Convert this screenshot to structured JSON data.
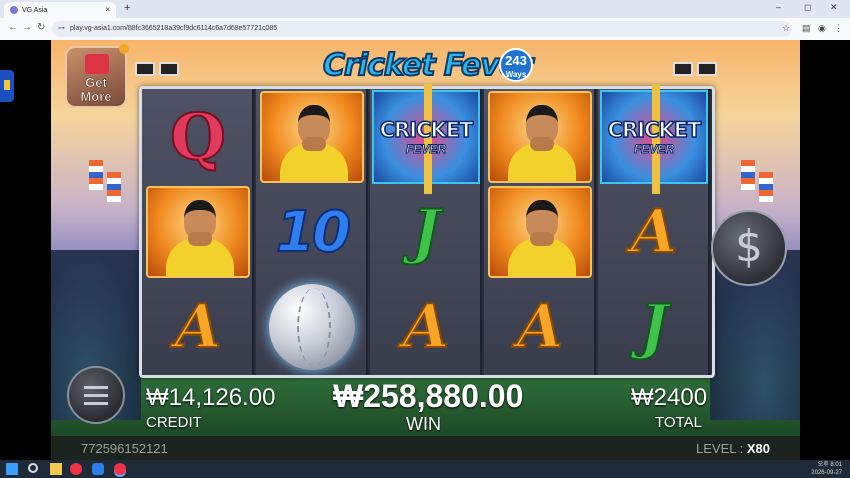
{
  "browser": {
    "tab_title": "VG Asia",
    "tab_close": "×",
    "new_tab": "+",
    "url": "play.vg-asia1.com/88fc3665218a39cf9dc6114c6a7d68e57721c085",
    "nav_back": "←",
    "nav_forward": "→",
    "nav_reload": "↻",
    "win_min": "–",
    "win_max": "◻",
    "win_close": "✕"
  },
  "game": {
    "logo_text": "Cricket Fever",
    "logo_ways": "243",
    "logo_ways_label": "Ways",
    "get_more_line1": "Get",
    "get_more_line2": "More",
    "spin_symbol": "$",
    "wild_line1": "CRICKET",
    "wild_line2": "FEVER",
    "reels": [
      [
        "Q",
        "player",
        "A"
      ],
      [
        "player",
        "10",
        "ball"
      ],
      [
        "wild",
        "J",
        "A"
      ],
      [
        "player",
        "player",
        "A"
      ],
      [
        "wild",
        "A",
        "J"
      ]
    ]
  },
  "hud": {
    "credit_value": "₩14,126.00",
    "credit_label": "CREDIT",
    "win_value": "₩258,880.00",
    "win_label": "WIN",
    "total_value": "₩2400",
    "total_label": "TOTAL"
  },
  "footer": {
    "session_id": "772596152121",
    "level_label": "LEVEL : ",
    "level_value": "X80"
  },
  "taskbar": {
    "time": "오후 8:01",
    "date": "2026-09-27"
  }
}
